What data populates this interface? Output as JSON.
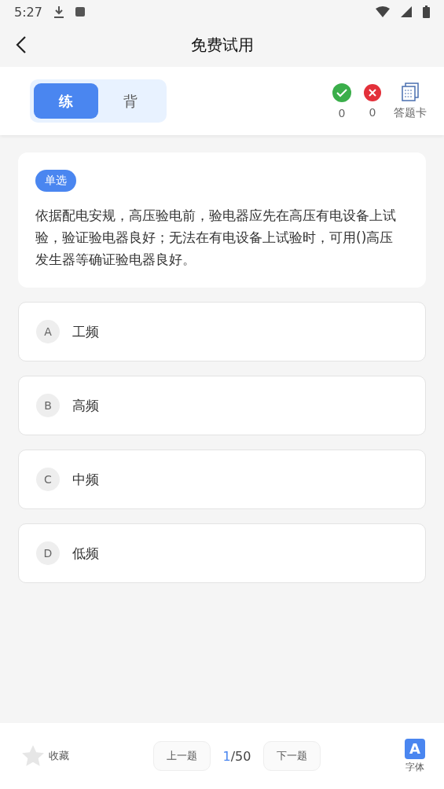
{
  "status_bar": {
    "time": "5:27"
  },
  "header": {
    "title": "免费试用"
  },
  "mode_tabs": [
    {
      "label": "练",
      "selected": true
    },
    {
      "label": "背",
      "selected": false
    }
  ],
  "stats": {
    "correct": "0",
    "wrong": "0",
    "answer_card": "答题卡"
  },
  "question": {
    "type": "单选",
    "text": "依据配电安规，高压验电前，验电器应先在高压有电设备上试验，验证验电器良好；无法在有电设备上试验时，可用()高压发生器等确证验电器良好。"
  },
  "options": [
    {
      "letter": "A",
      "text": "工频",
      "selected": false
    },
    {
      "letter": "B",
      "text": "高频",
      "selected": false
    },
    {
      "letter": "C",
      "text": "中频",
      "selected": false
    },
    {
      "letter": "D",
      "text": "低频",
      "selected": false
    }
  ],
  "bottom_bar": {
    "favorite": {
      "label": "收藏",
      "on": false
    },
    "prev": "上一题",
    "current": "1",
    "total": "/50",
    "next": "下一题",
    "font": {
      "letter": "A",
      "label": "字体"
    }
  }
}
